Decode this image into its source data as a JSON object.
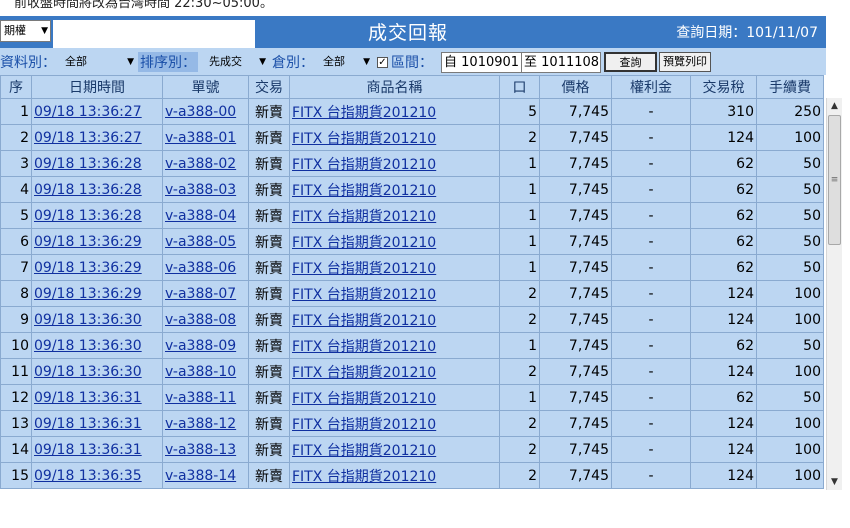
{
  "top_note": "前收盤時間將改為台灣時間 22:30~05:00。",
  "header": {
    "market_select": "期權",
    "title": "成交回報",
    "query_date_label": "查詢日期：101/11/07"
  },
  "filters": {
    "data_type_label": "資料別：",
    "data_type_value": "全部",
    "sort_label": "排序別：",
    "sort_value": "先成交",
    "account_label": "倉別：",
    "account_value": "全部",
    "range_checked": "✓",
    "range_label": "區間：",
    "from_label": "自",
    "from_value": "1010901",
    "to_label": "至",
    "to_value": "1011108",
    "query_button": "查詢",
    "print_button": "預覽列印"
  },
  "table": {
    "columns": [
      "序",
      "日期時間",
      "單號",
      "交易",
      "商品名稱",
      "口",
      "價格",
      "權利金",
      "交易稅",
      "手續費"
    ],
    "rows": [
      [
        "1",
        "09/18 13:36:27",
        "v-a388-00",
        "新賣",
        "FITX 台指期貨201210",
        "5",
        "7,745",
        "-",
        "310",
        "250"
      ],
      [
        "2",
        "09/18 13:36:27",
        "v-a388-01",
        "新賣",
        "FITX 台指期貨201210",
        "2",
        "7,745",
        "-",
        "124",
        "100"
      ],
      [
        "3",
        "09/18 13:36:28",
        "v-a388-02",
        "新賣",
        "FITX 台指期貨201210",
        "1",
        "7,745",
        "-",
        "62",
        "50"
      ],
      [
        "4",
        "09/18 13:36:28",
        "v-a388-03",
        "新賣",
        "FITX 台指期貨201210",
        "1",
        "7,745",
        "-",
        "62",
        "50"
      ],
      [
        "5",
        "09/18 13:36:28",
        "v-a388-04",
        "新賣",
        "FITX 台指期貨201210",
        "1",
        "7,745",
        "-",
        "62",
        "50"
      ],
      [
        "6",
        "09/18 13:36:29",
        "v-a388-05",
        "新賣",
        "FITX 台指期貨201210",
        "1",
        "7,745",
        "-",
        "62",
        "50"
      ],
      [
        "7",
        "09/18 13:36:29",
        "v-a388-06",
        "新賣",
        "FITX 台指期貨201210",
        "1",
        "7,745",
        "-",
        "62",
        "50"
      ],
      [
        "8",
        "09/18 13:36:29",
        "v-a388-07",
        "新賣",
        "FITX 台指期貨201210",
        "2",
        "7,745",
        "-",
        "124",
        "100"
      ],
      [
        "9",
        "09/18 13:36:30",
        "v-a388-08",
        "新賣",
        "FITX 台指期貨201210",
        "2",
        "7,745",
        "-",
        "124",
        "100"
      ],
      [
        "10",
        "09/18 13:36:30",
        "v-a388-09",
        "新賣",
        "FITX 台指期貨201210",
        "1",
        "7,745",
        "-",
        "62",
        "50"
      ],
      [
        "11",
        "09/18 13:36:30",
        "v-a388-10",
        "新賣",
        "FITX 台指期貨201210",
        "2",
        "7,745",
        "-",
        "124",
        "100"
      ],
      [
        "12",
        "09/18 13:36:31",
        "v-a388-11",
        "新賣",
        "FITX 台指期貨201210",
        "1",
        "7,745",
        "-",
        "62",
        "50"
      ],
      [
        "13",
        "09/18 13:36:31",
        "v-a388-12",
        "新賣",
        "FITX 台指期貨201210",
        "2",
        "7,745",
        "-",
        "124",
        "100"
      ],
      [
        "14",
        "09/18 13:36:31",
        "v-a388-13",
        "新賣",
        "FITX 台指期貨201210",
        "2",
        "7,745",
        "-",
        "124",
        "100"
      ],
      [
        "15",
        "09/18 13:36:35",
        "v-a388-14",
        "新賣",
        "FITX 台指期貨201210",
        "2",
        "7,745",
        "-",
        "124",
        "100"
      ]
    ]
  },
  "colors": {
    "header_bg": "#3a79c4",
    "row_bg": "#bcd6f2",
    "link": "#1030a0"
  }
}
